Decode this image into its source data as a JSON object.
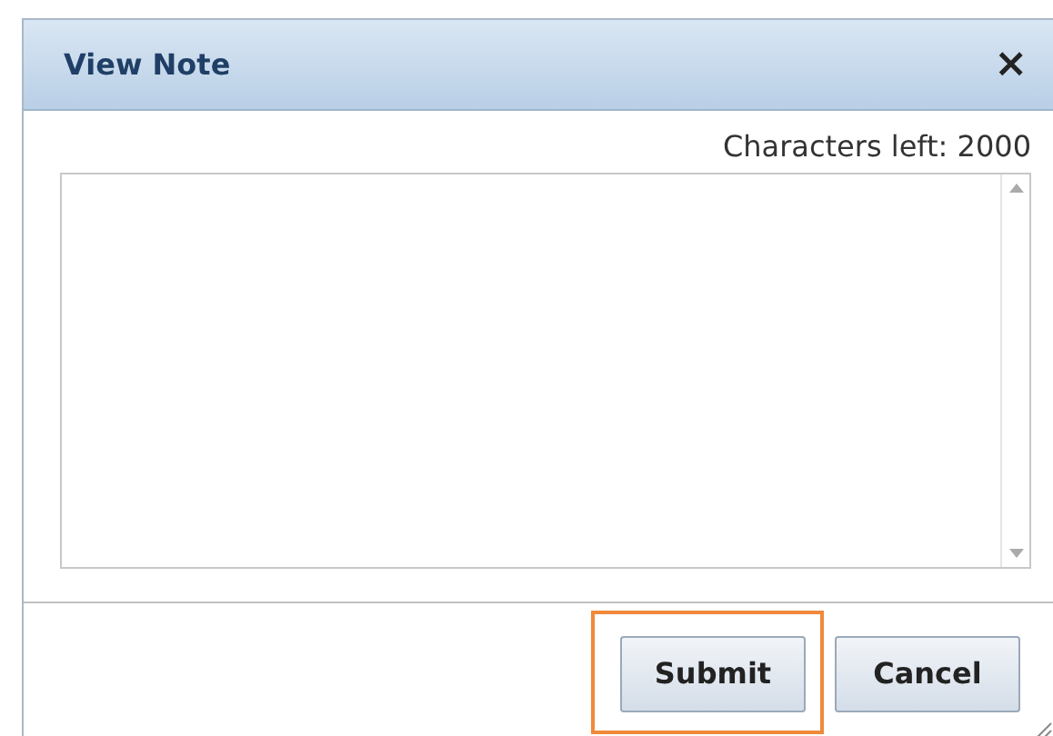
{
  "dialog": {
    "title": "View Note",
    "close": "×"
  },
  "counter": "Characters left: 2000",
  "buttons": [
    {
      "label": "Submit",
      "highlighted": true
    },
    {
      "label": "Cancel",
      "highlighted": false
    }
  ]
}
